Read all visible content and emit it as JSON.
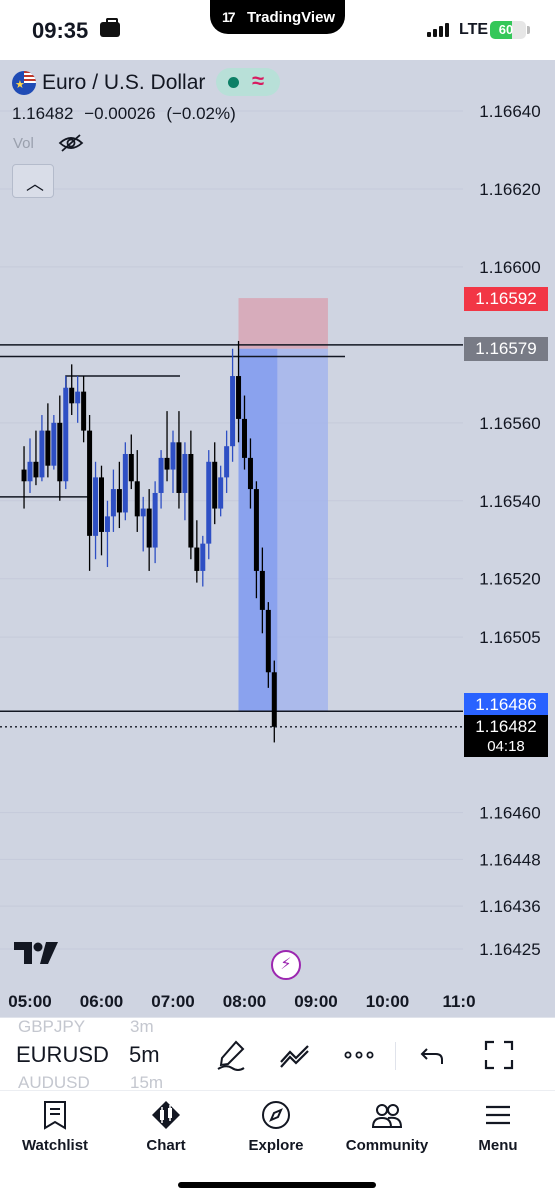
{
  "status_bar": {
    "time": "09:35",
    "app_pill": "TradingView",
    "network": "LTE",
    "battery_percent": 60,
    "battery_text": "60"
  },
  "header": {
    "symbol_title": "Euro / U.S. Dollar",
    "last_price": "1.16482",
    "change": "−0.00026",
    "change_pct": "(−0.02%)",
    "volume_label": "Vol"
  },
  "price_labels": {
    "stop_loss": "1.16592",
    "entry": "1.16579",
    "take_profit": "1.16486",
    "current": "1.16482",
    "countdown": "04:18"
  },
  "colors": {
    "chart_bg": "#cfd4e1",
    "bull_candle": "#2e4fc4",
    "bear_candle": "#000000",
    "stop_zone": "#d8a4b4",
    "target_zone": "#9fb2ee",
    "price_red": "#f23645",
    "price_blue": "#2962ff"
  },
  "chart_data": {
    "type": "candlestick",
    "symbol": "EURUSD",
    "interval": "5m",
    "y_ticks": [
      1.1664,
      1.1662,
      1.166,
      1.1656,
      1.1654,
      1.1652,
      1.16505,
      1.1646,
      1.16448,
      1.16436,
      1.16425
    ],
    "y_tick_labels": [
      "1.16640",
      "1.16620",
      "1.16600",
      "1.16560",
      "1.16540",
      "1.16520",
      "1.16505",
      "1.16460",
      "1.16448",
      "1.16436",
      "1.16425"
    ],
    "x_ticks": [
      "05:00",
      "06:00",
      "07:00",
      "08:00",
      "09:00",
      "10:00",
      "11:0"
    ],
    "horizontal_lines": [
      1.1658,
      1.16577,
      1.16541,
      1.16486
    ],
    "position_tool": {
      "entry": 1.16579,
      "stop": 1.16592,
      "target": 1.16486,
      "start_time": "08:00",
      "end_time": "09:05"
    },
    "candles": [
      {
        "t": "04:55",
        "o": 1.16548,
        "h": 1.16554,
        "l": 1.16538,
        "c": 1.16545
      },
      {
        "t": "05:00",
        "o": 1.16545,
        "h": 1.16556,
        "l": 1.16542,
        "c": 1.1655
      },
      {
        "t": "05:05",
        "o": 1.1655,
        "h": 1.16558,
        "l": 1.16544,
        "c": 1.16546
      },
      {
        "t": "05:10",
        "o": 1.16546,
        "h": 1.16562,
        "l": 1.16545,
        "c": 1.16558
      },
      {
        "t": "05:15",
        "o": 1.16558,
        "h": 1.16565,
        "l": 1.16546,
        "c": 1.16549
      },
      {
        "t": "05:20",
        "o": 1.16549,
        "h": 1.16562,
        "l": 1.16548,
        "c": 1.1656
      },
      {
        "t": "05:25",
        "o": 1.1656,
        "h": 1.16567,
        "l": 1.1654,
        "c": 1.16545
      },
      {
        "t": "05:30",
        "o": 1.16545,
        "h": 1.16572,
        "l": 1.16543,
        "c": 1.16569
      },
      {
        "t": "05:35",
        "o": 1.16569,
        "h": 1.16575,
        "l": 1.16562,
        "c": 1.16565
      },
      {
        "t": "05:40",
        "o": 1.16565,
        "h": 1.16572,
        "l": 1.1656,
        "c": 1.16568
      },
      {
        "t": "05:45",
        "o": 1.16568,
        "h": 1.16572,
        "l": 1.16555,
        "c": 1.16558
      },
      {
        "t": "05:50",
        "o": 1.16558,
        "h": 1.16562,
        "l": 1.16522,
        "c": 1.16531
      },
      {
        "t": "05:55",
        "o": 1.16531,
        "h": 1.1655,
        "l": 1.16525,
        "c": 1.16546
      },
      {
        "t": "06:00",
        "o": 1.16546,
        "h": 1.16549,
        "l": 1.16526,
        "c": 1.16532
      },
      {
        "t": "06:05",
        "o": 1.16532,
        "h": 1.1654,
        "l": 1.16523,
        "c": 1.16536
      },
      {
        "t": "06:10",
        "o": 1.16536,
        "h": 1.16548,
        "l": 1.16532,
        "c": 1.16543
      },
      {
        "t": "06:15",
        "o": 1.16543,
        "h": 1.1655,
        "l": 1.16533,
        "c": 1.16537
      },
      {
        "t": "06:20",
        "o": 1.16537,
        "h": 1.16555,
        "l": 1.16535,
        "c": 1.16552
      },
      {
        "t": "06:25",
        "o": 1.16552,
        "h": 1.16557,
        "l": 1.16543,
        "c": 1.16545
      },
      {
        "t": "06:30",
        "o": 1.16545,
        "h": 1.16553,
        "l": 1.16532,
        "c": 1.16536
      },
      {
        "t": "06:35",
        "o": 1.16536,
        "h": 1.16541,
        "l": 1.16527,
        "c": 1.16538
      },
      {
        "t": "06:40",
        "o": 1.16538,
        "h": 1.16543,
        "l": 1.16522,
        "c": 1.16528
      },
      {
        "t": "06:45",
        "o": 1.16528,
        "h": 1.16545,
        "l": 1.16524,
        "c": 1.16542
      },
      {
        "t": "06:50",
        "o": 1.16542,
        "h": 1.16553,
        "l": 1.16538,
        "c": 1.16551
      },
      {
        "t": "06:55",
        "o": 1.16551,
        "h": 1.16563,
        "l": 1.16545,
        "c": 1.16548
      },
      {
        "t": "07:00",
        "o": 1.16548,
        "h": 1.16558,
        "l": 1.16542,
        "c": 1.16555
      },
      {
        "t": "07:05",
        "o": 1.16555,
        "h": 1.16563,
        "l": 1.16538,
        "c": 1.16542
      },
      {
        "t": "07:10",
        "o": 1.16542,
        "h": 1.16555,
        "l": 1.16535,
        "c": 1.16552
      },
      {
        "t": "07:15",
        "o": 1.16552,
        "h": 1.16558,
        "l": 1.16525,
        "c": 1.16528
      },
      {
        "t": "07:20",
        "o": 1.16528,
        "h": 1.16535,
        "l": 1.16519,
        "c": 1.16522
      },
      {
        "t": "07:25",
        "o": 1.16522,
        "h": 1.16531,
        "l": 1.16518,
        "c": 1.16529
      },
      {
        "t": "07:30",
        "o": 1.16529,
        "h": 1.16553,
        "l": 1.16525,
        "c": 1.1655
      },
      {
        "t": "07:35",
        "o": 1.1655,
        "h": 1.16555,
        "l": 1.16534,
        "c": 1.16538
      },
      {
        "t": "07:40",
        "o": 1.16538,
        "h": 1.16549,
        "l": 1.16536,
        "c": 1.16546
      },
      {
        "t": "07:45",
        "o": 1.16546,
        "h": 1.16558,
        "l": 1.16542,
        "c": 1.16554
      },
      {
        "t": "07:50",
        "o": 1.16554,
        "h": 1.16579,
        "l": 1.1655,
        "c": 1.16572
      },
      {
        "t": "07:55",
        "o": 1.16572,
        "h": 1.16581,
        "l": 1.16555,
        "c": 1.16561
      },
      {
        "t": "08:00",
        "o": 1.16561,
        "h": 1.16567,
        "l": 1.16548,
        "c": 1.16551
      },
      {
        "t": "08:05",
        "o": 1.16551,
        "h": 1.16556,
        "l": 1.16538,
        "c": 1.16543
      },
      {
        "t": "08:10",
        "o": 1.16543,
        "h": 1.16545,
        "l": 1.16515,
        "c": 1.16522
      },
      {
        "t": "08:15",
        "o": 1.16522,
        "h": 1.16528,
        "l": 1.16506,
        "c": 1.16512
      },
      {
        "t": "08:20",
        "o": 1.16512,
        "h": 1.16514,
        "l": 1.16492,
        "c": 1.16496
      },
      {
        "t": "08:25",
        "o": 1.16496,
        "h": 1.16499,
        "l": 1.16478,
        "c": 1.16482
      }
    ]
  },
  "toolbar": {
    "ghost_prev_symbol": "GBPJPY",
    "ghost_prev_interval": "3m",
    "symbol": "EURUSD",
    "interval": "5m",
    "ghost_next_symbol": "AUDUSD",
    "ghost_next_interval": "15m"
  },
  "nav": {
    "watchlist": "Watchlist",
    "chart": "Chart",
    "explore": "Explore",
    "community": "Community",
    "menu": "Menu"
  }
}
